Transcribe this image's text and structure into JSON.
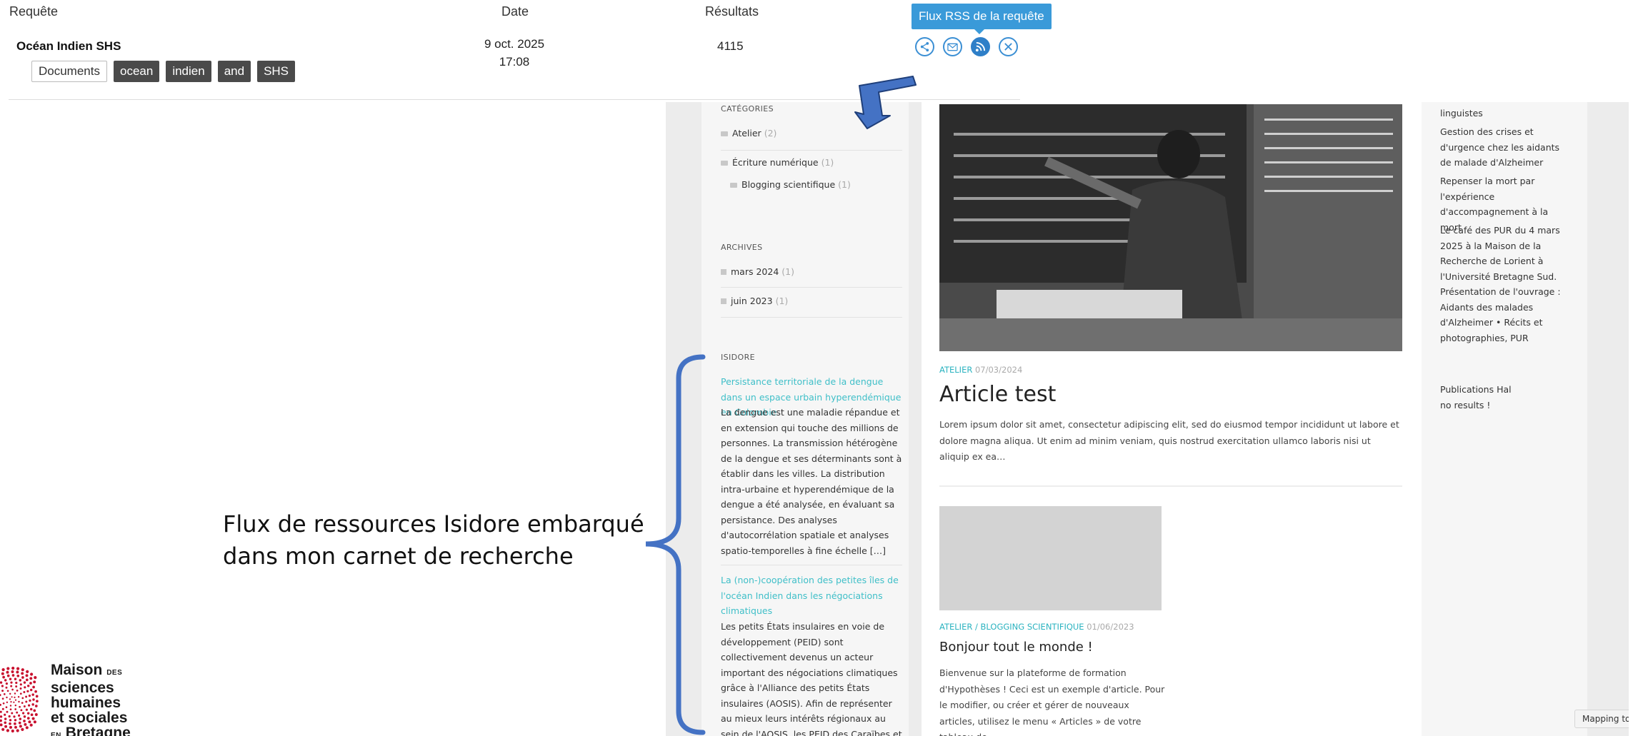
{
  "query_table": {
    "headers": {
      "query": "Requête",
      "date": "Date",
      "results": "Résultats"
    },
    "row": {
      "name": "Océan Indien SHS",
      "tags": [
        "Documents",
        "ocean",
        "indien",
        "and",
        "SHS"
      ],
      "date_line1": "9 oct. 2025",
      "date_line2": "17:08",
      "results": "4115"
    },
    "actions": [
      {
        "icon": "share-icon"
      },
      {
        "icon": "email-icon"
      },
      {
        "icon": "rss-icon"
      },
      {
        "icon": "close-icon"
      }
    ],
    "tooltip": "Flux RSS de la requête",
    "accent_color": "#3a9ad9"
  },
  "blog": {
    "categories_title": "CATÉGORIES",
    "categories": [
      {
        "label": "Atelier",
        "count": "(2)"
      },
      {
        "label": "Écriture numérique",
        "count": "(1)"
      },
      {
        "label": "Blogging scientifique",
        "count": "(1)"
      }
    ],
    "archives_title": "ARCHIVES",
    "archives": [
      {
        "label": "mars 2024",
        "count": "(1)"
      },
      {
        "label": "juin 2023",
        "count": "(1)"
      }
    ],
    "isidore_title": "ISIDORE",
    "isidore_items": [
      {
        "title": "Persistance territoriale de la dengue dans un espace urbain hyperendémique en Colombie",
        "text": "La dengue est une maladie répandue et en extension qui touche des millions de personnes. La transmission hétérogène de la dengue et ses déterminants sont à établir dans les villes. La distribution intra-urbaine et hyperendémique de la dengue a été analysée, en évaluant sa persistance. Des analyses d'autocorrélation spatiale et analyses spatio-temporelles à fine échelle […]"
      },
      {
        "title": "La (non-)coopération des petites îles de l'océan Indien dans les négociations climatiques",
        "text": "Les petits États insulaires en voie de développement (PEID) sont collectivement devenus un acteur important des négociations climatiques grâce à l'Alliance des petits États insulaires (AOSIS). Afin de représenter au mieux leurs intérêts régionaux au sein de l'AOSIS, les PEID des Caraïbes et ceux du Pacifique se"
      }
    ],
    "posts": [
      {
        "category": "ATELIER",
        "date": "07/03/2024",
        "title": "Article test",
        "excerpt": "Lorem ipsum dolor sit amet, consectetur adipiscing elit, sed do eiusmod tempor incididunt ut labore et dolore magna aliqua. Ut enim ad minim veniam, quis nostrud exercitation ullamco laboris nisi ut aliquip ex ea…"
      },
      {
        "category": "ATELIER / BLOGGING SCIENTIFIQUE",
        "date": "01/06/2023",
        "title": "Bonjour tout le monde !",
        "excerpt": "Bienvenue sur la plateforme de formation d'Hypothèses ! Ceci est un exemple d'article. Pour le modifier, ou créer et gérer de nouveaux articles, utilisez le menu « Articles » de votre tableau de"
      }
    ],
    "right_sidebar": {
      "item0": "linguistes",
      "item1": "Gestion des crises et d'urgence chez les aidants de malade d'Alzheimer",
      "item2": "Repenser la mort par l'expérience d'accompagnement à la mort",
      "item3": "Le café des PUR du 4 mars 2025 à la Maison de la Recherche de Lorient à l'Université Bretagne Sud. Présentation de l'ouvrage : Aidants des malades d'Alzheimer • Récits et photographies, PUR",
      "hal_title": "Publications Hal",
      "hal_text": "no results !"
    },
    "mapping_button": "Mapping to"
  },
  "annotation": {
    "line1": "Flux de ressources Isidore embarqué",
    "line2": "dans mon carnet de recherche",
    "bracket_color": "#4472c4"
  },
  "logo": {
    "line1": "Maison",
    "des": "DES",
    "line2": "sciences",
    "line3": "humaines",
    "line4": "et sociales",
    "en": "EN",
    "line5": "Bretagne"
  }
}
